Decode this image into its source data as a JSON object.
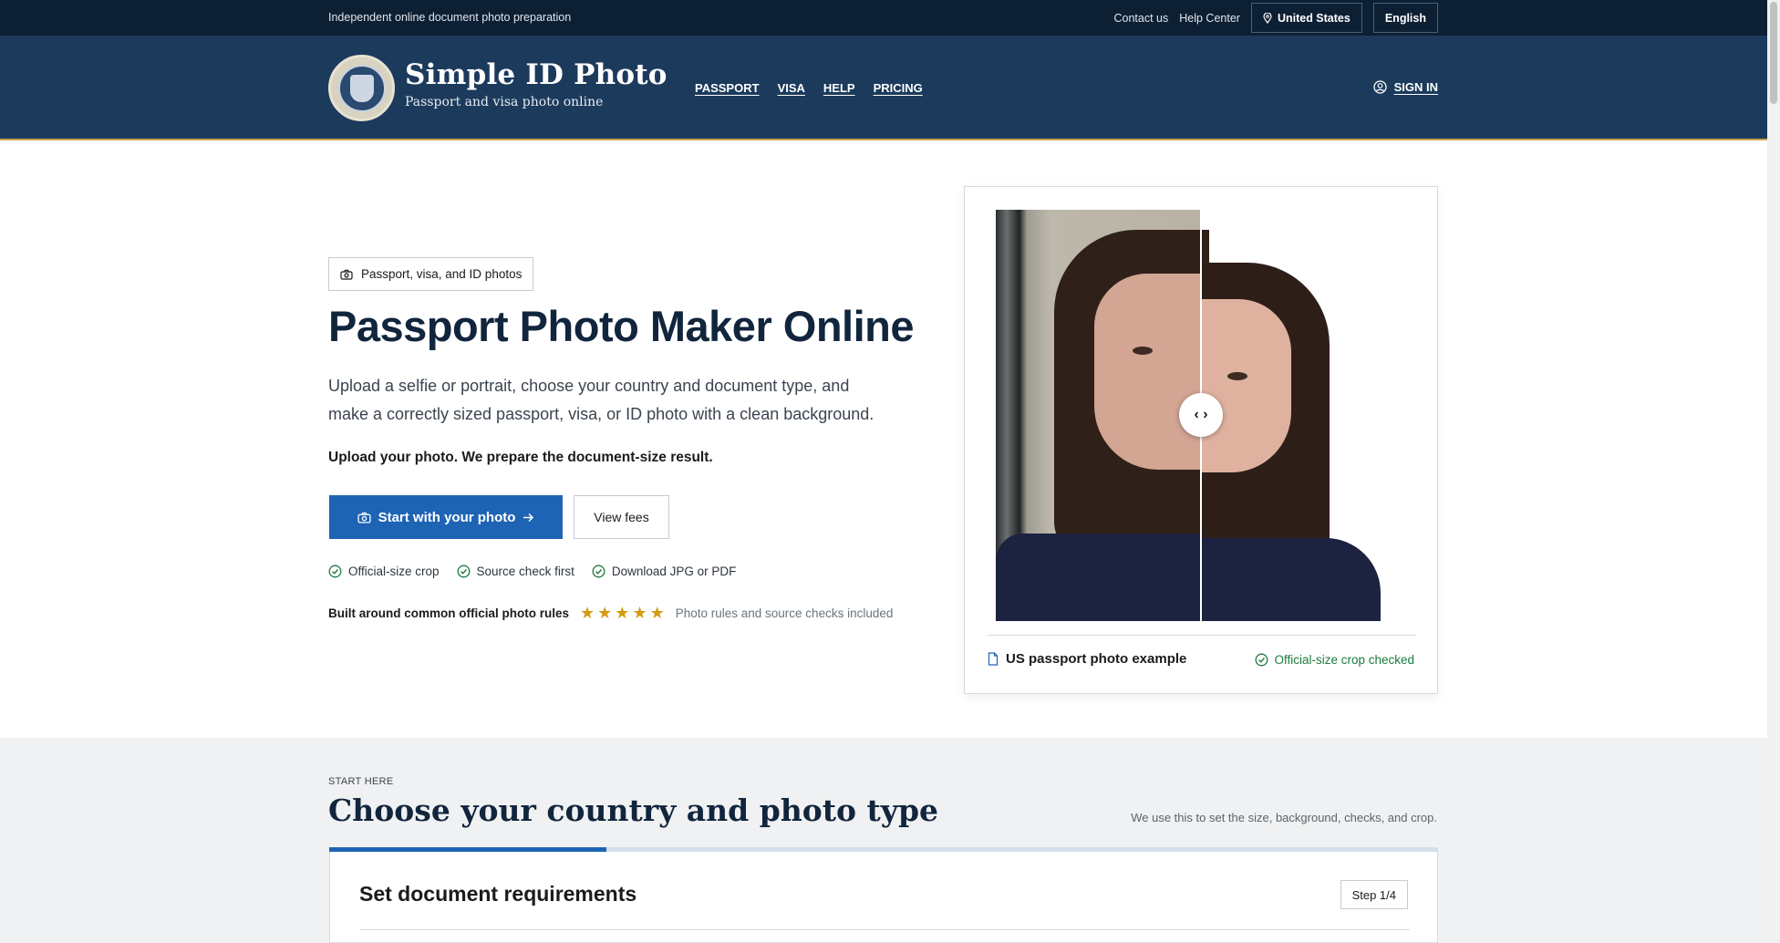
{
  "topbar": {
    "tagline": "Independent online document photo preparation",
    "contact": "Contact us",
    "help_center": "Help Center",
    "country": "United States",
    "language": "English"
  },
  "header": {
    "brand_name": "Simple ID Photo",
    "brand_sub": "Passport and visa photo online",
    "nav": [
      "PASSPORT",
      "VISA",
      "HELP",
      "PRICING"
    ],
    "sign_in": "SIGN IN"
  },
  "hero": {
    "badge": "Passport, visa, and ID photos",
    "title": "Passport Photo Maker Online",
    "lead": "Upload a selfie or portrait, choose your country and document type, and make a correctly sized passport, visa, or ID photo with a clean background.",
    "strong": "Upload your photo. We prepare the document-size result.",
    "primary_button": "Start with your photo",
    "secondary_button": "View fees",
    "checks": [
      "Official-size crop",
      "Source check first",
      "Download JPG or PDF"
    ],
    "rating_label": "Built around common official photo rules",
    "rating_stars": 5,
    "rating_note": "Photo rules and source checks included"
  },
  "photo_card": {
    "caption": "US passport photo example",
    "status": "Official-size crop checked",
    "compare_handle": "‹ ›"
  },
  "start": {
    "eyebrow": "START HERE",
    "title": "Choose your country and photo type",
    "hint": "We use this to set the size, background, checks, and crop.",
    "progress": 0.25,
    "panel_title": "Set document requirements",
    "step": "Step 1/4"
  },
  "colors": {
    "topbar": "#0d1f33",
    "header": "#1c3a5c",
    "primary": "#1e64b4",
    "gold": "#c9a64a",
    "success": "#1c7a3c",
    "star": "#d49b12"
  },
  "icons": [
    "pin-icon",
    "user-circle-icon",
    "camera-icon",
    "arrow-right-icon",
    "check-circle-icon",
    "star-icon",
    "document-icon",
    "compare-icon"
  ]
}
